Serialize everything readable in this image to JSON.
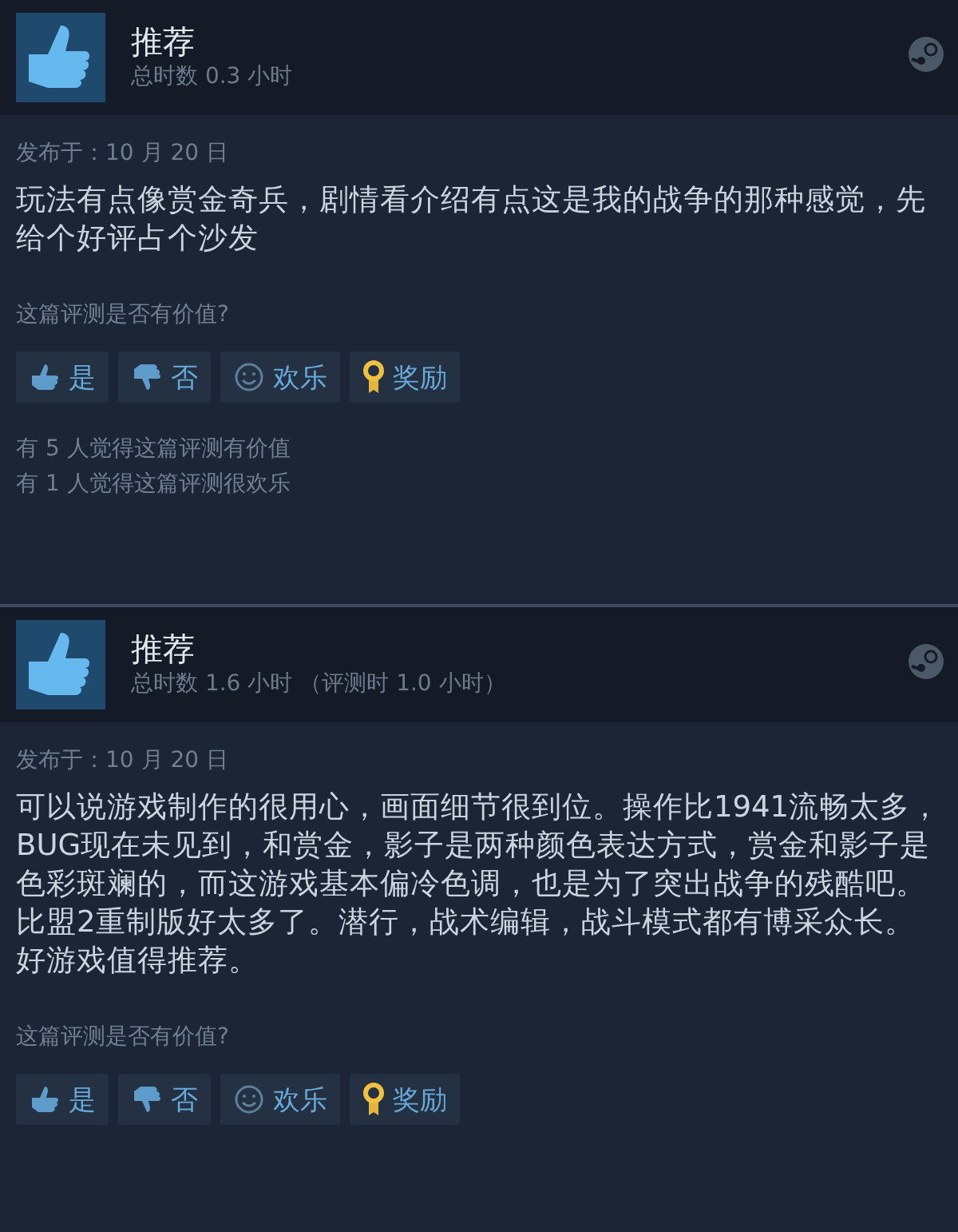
{
  "reviews": [
    {
      "verdict": "推荐",
      "hours": "总时数 0.3 小时",
      "date": "发布于：10 月 20 日",
      "text": "玩法有点像赏金奇兵，剧情看介绍有点这是我的战争的那种感觉，先给个好评占个沙发",
      "question": "这篇评测是否有价值?",
      "buttons": [
        {
          "kind": "up",
          "label": "是"
        },
        {
          "kind": "down",
          "label": "否"
        },
        {
          "kind": "funny",
          "label": "欢乐"
        },
        {
          "kind": "award",
          "label": "奖励"
        }
      ],
      "stats": [
        "有 5 人觉得这篇评测有价值",
        "有 1 人觉得这篇评测很欢乐"
      ]
    },
    {
      "verdict": "推荐",
      "hours": "总时数 1.6 小时 （评测时 1.0 小时）",
      "date": "发布于：10 月 20 日",
      "text": "可以说游戏制作的很用心，画面细节很到位。操作比1941流畅太多，BUG现在未见到，和赏金，影子是两种颜色表达方式，赏金和影子是色彩斑斓的，而这游戏基本偏冷色调，也是为了突出战争的残酷吧。比盟2重制版好太多了。潜行，战术编辑，战斗模式都有博采众长。好游戏值得推荐。",
      "question": "这篇评测是否有价值?",
      "buttons": [
        {
          "kind": "up",
          "label": "是"
        },
        {
          "kind": "down",
          "label": "否"
        },
        {
          "kind": "funny",
          "label": "欢乐"
        },
        {
          "kind": "award",
          "label": "奖励"
        }
      ]
    }
  ]
}
